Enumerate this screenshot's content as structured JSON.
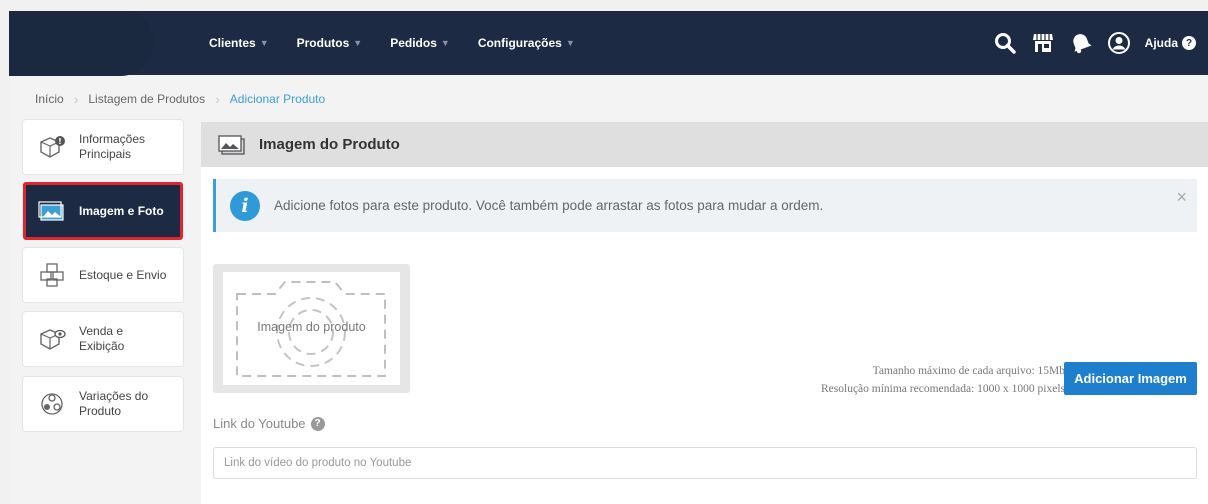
{
  "nav": {
    "items": [
      {
        "label": "Clientes"
      },
      {
        "label": "Produtos"
      },
      {
        "label": "Pedidos"
      },
      {
        "label": "Configurações"
      }
    ],
    "help_label": "Ajuda",
    "help_glyph": "?",
    "icons": [
      "search-icon",
      "store-icon",
      "notification-icon",
      "user-icon"
    ]
  },
  "breadcrumb": {
    "items": [
      "Início",
      "Listagem de Produtos",
      "Adicionar Produto"
    ]
  },
  "sidebar": {
    "items": [
      {
        "label_line1": "Informações",
        "label_line2": "Principais",
        "icon": "box-info-icon"
      },
      {
        "label_line1": "Imagem e Foto",
        "label_line2": "",
        "icon": "image-icon",
        "active": true
      },
      {
        "label_line1": "Estoque e Envio",
        "label_line2": "",
        "icon": "boxes-stack-icon"
      },
      {
        "label_line1": "Venda e",
        "label_line2": "Exibição",
        "icon": "box-eye-icon"
      },
      {
        "label_line1": "Variações do",
        "label_line2": "Produto",
        "icon": "variations-icon"
      }
    ]
  },
  "panel": {
    "title": "Imagem do Produto",
    "alert_text": "Adicione fotos para este produto. Você também pode arrastar as fotos para mudar a ordem.",
    "alert_icon_glyph": "i",
    "alert_close": "×",
    "placeholder_label": "Imagem do produto",
    "upload_info_line1": "Tamanho máximo de cada arquivo: 15Mb",
    "upload_info_line2": "Resolução mínima recomendada: 1000 x 1000 pixels",
    "upload_button": "Adicionar Imagem",
    "youtube_label": "Link do Youtube",
    "youtube_help_glyph": "?",
    "youtube_placeholder": "Link do vídeo do produto no Youtube",
    "youtube_value": ""
  },
  "colors": {
    "topbar": "#1c2a43",
    "accent": "#3c9fd6",
    "button": "#1d7fcd",
    "active_border": "#e0252f"
  }
}
